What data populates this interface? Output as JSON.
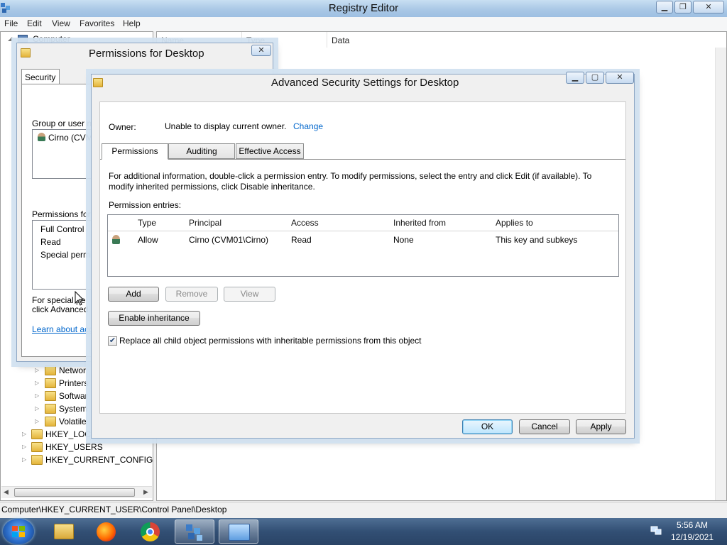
{
  "regedit": {
    "title": "Registry Editor",
    "caption_buttons": {
      "minimize": "▁",
      "restore": "❐",
      "close": "✕"
    },
    "menu": [
      "File",
      "Edit",
      "View",
      "Favorites",
      "Help"
    ],
    "list_columns": [
      "Name",
      "Type",
      "Data"
    ],
    "tree": {
      "root": "Computer",
      "partial_children": [
        "Networ",
        "Printers",
        "Softwar",
        "System",
        "Volatile"
      ],
      "hives": [
        "HKEY_LOC",
        "HKEY_USERS",
        "HKEY_CURRENT_CONFIG"
      ]
    },
    "status": "Computer\\HKEY_CURRENT_USER\\Control Panel\\Desktop"
  },
  "perm_dialog": {
    "title": "Permissions for Desktop",
    "close": "✕",
    "tab": "Security",
    "group_label": "Group or user na",
    "user": "Cirno (CVM",
    "permissions_for": "Permissions for C",
    "perm_items": [
      "Full Control",
      "Read",
      "Special permi"
    ],
    "special_text_1": "For special pe",
    "special_text_2": "click Advanced",
    "learn_link": "Learn about acc"
  },
  "adv_dialog": {
    "title": "Advanced Security Settings for Desktop",
    "caption_buttons": {
      "minimize": "▁",
      "maximize": "▢",
      "close": "✕"
    },
    "owner_label": "Owner:",
    "owner_value": "Unable to display current owner.",
    "owner_change": "Change",
    "tabs": [
      "Permissions",
      "Auditing",
      "Effective Access"
    ],
    "info_line1": "For additional information, double-click a permission entry. To modify permissions, select the entry and click Edit (if available). To",
    "info_line2": "modify inherited permissions, click Disable inheritance.",
    "entries_label": "Permission entries:",
    "columns": [
      "Type",
      "Principal",
      "Access",
      "Inherited from",
      "Applies to"
    ],
    "entry": {
      "type": "Allow",
      "principal": "Cirno (CVM01\\Cirno)",
      "access": "Read",
      "inherited": "None",
      "applies": "This key and subkeys"
    },
    "add": "Add",
    "remove": "Remove",
    "view": "View",
    "enable_inheritance": "Enable inheritance",
    "replace_checkbox": "Replace all child object permissions with inheritable permissions from this object",
    "replace_checked": true,
    "ok": "OK",
    "cancel": "Cancel",
    "apply": "Apply"
  },
  "taskbar": {
    "apps": [
      "explorer-icon",
      "firefox-icon",
      "chrome-icon",
      "regedit-icon",
      "control-panel-icon"
    ],
    "time": "5:56 AM",
    "date": "12/19/2021"
  }
}
